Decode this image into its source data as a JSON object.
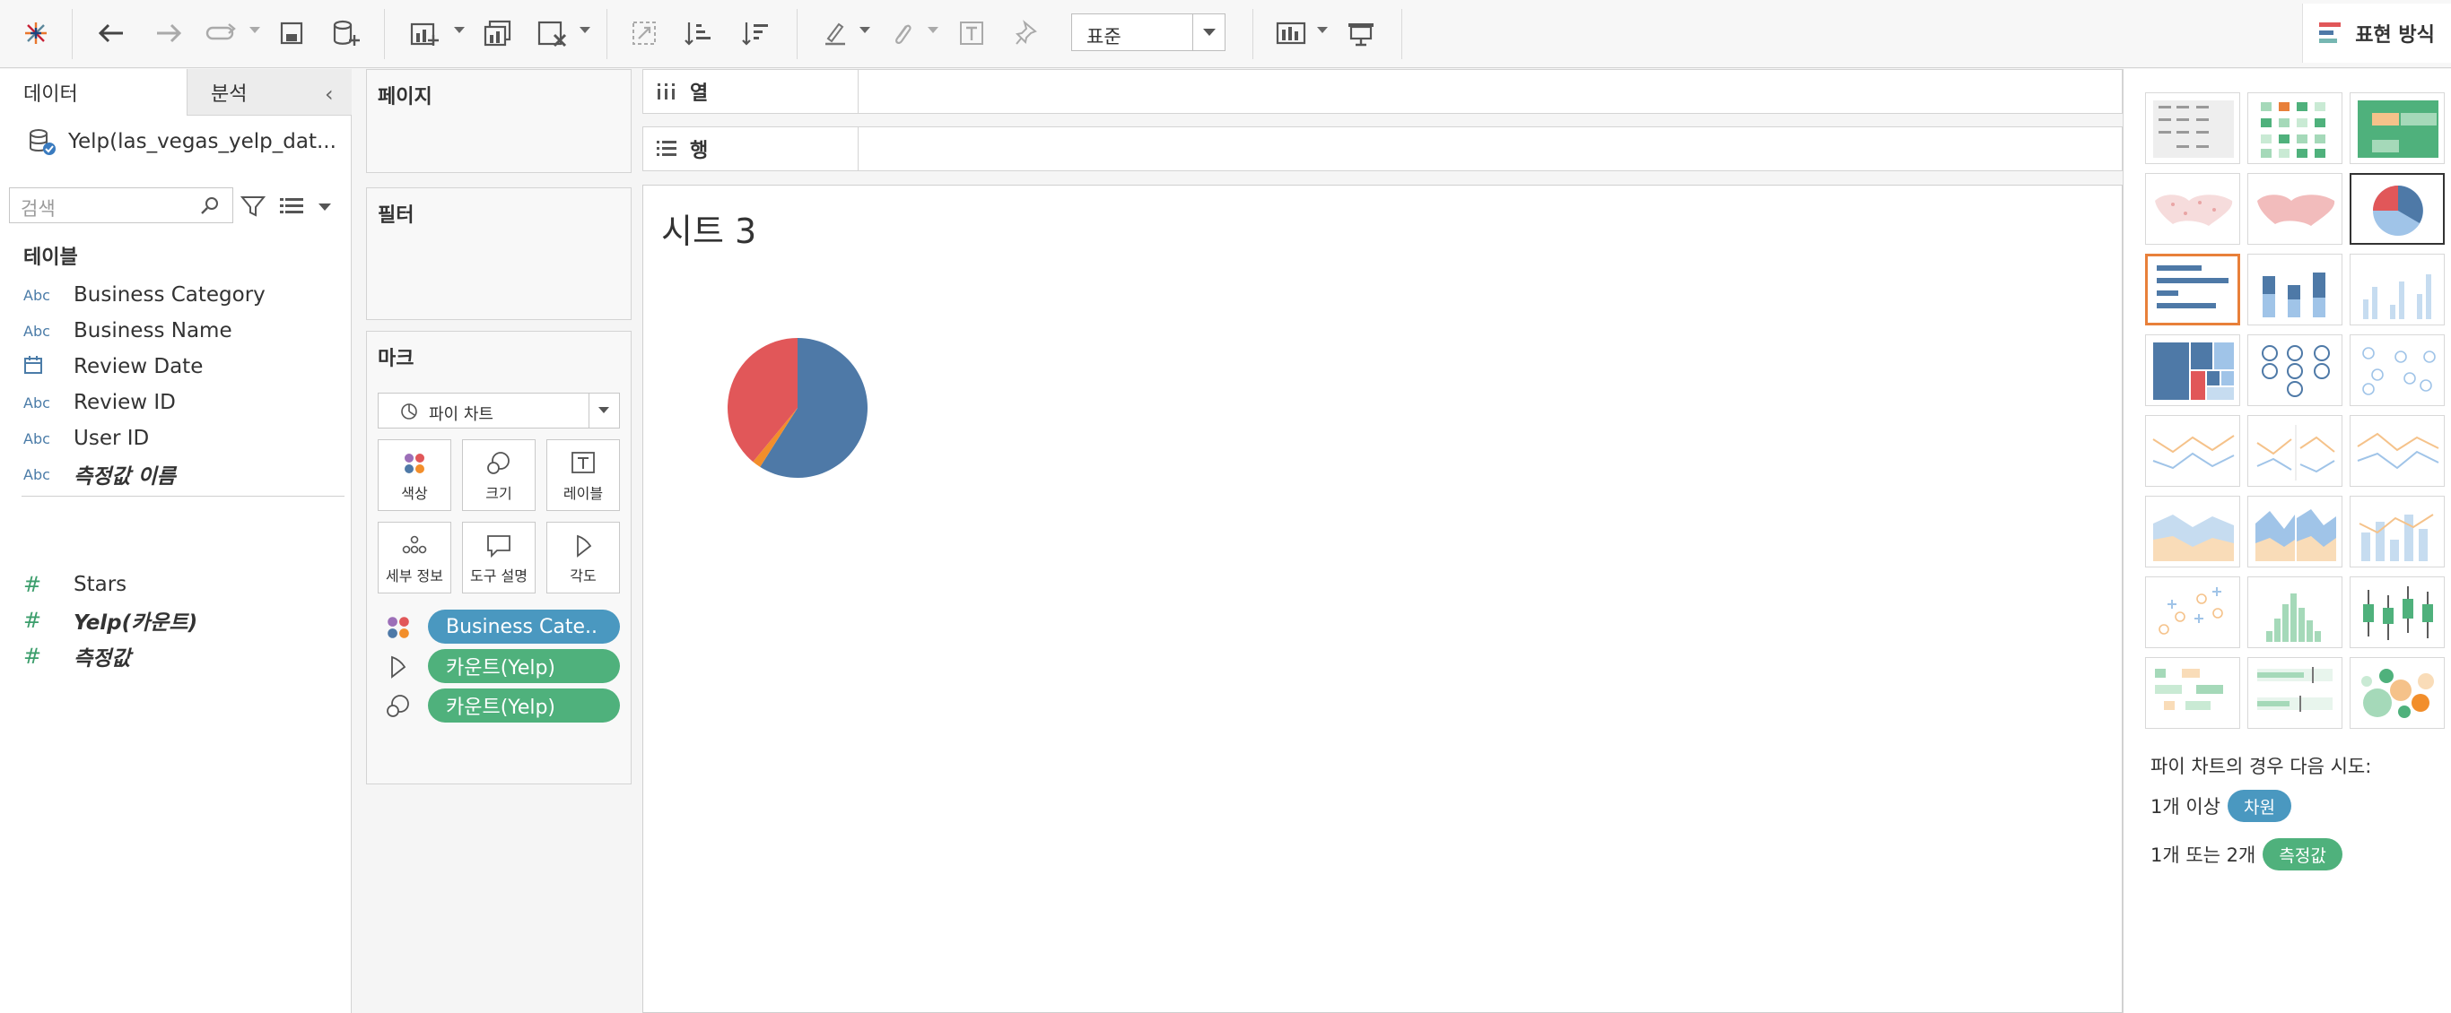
{
  "toolbar": {
    "fit_value": "표준",
    "show_me_label": "표현 방식"
  },
  "data_pane": {
    "tab_data": "데이터",
    "tab_analysis": "분석",
    "datasource": "Yelp(las_vegas_yelp_dat...",
    "search_placeholder": "검색",
    "tables_title": "테이블",
    "fields": [
      {
        "type": "Abc",
        "name": "Business Category"
      },
      {
        "type": "Abc",
        "name": "Business Name"
      },
      {
        "type": "date",
        "name": "Review Date"
      },
      {
        "type": "Abc",
        "name": "Review ID"
      },
      {
        "type": "Abc",
        "name": "User ID"
      },
      {
        "type": "Abc",
        "name": "측정값 이름"
      },
      {
        "type": "#",
        "name": "Stars"
      },
      {
        "type": "#",
        "name": "Yelp(카운트)"
      },
      {
        "type": "#",
        "name": "측정값"
      }
    ]
  },
  "cards": {
    "pages_title": "페이지",
    "filters_title": "필터",
    "marks_title": "마크",
    "marks_type": "파이 차트",
    "mark_buttons": [
      "색상",
      "크기",
      "레이블",
      "세부 정보",
      "도구 설명",
      "각도"
    ],
    "pills": [
      {
        "label": "Business Cate..",
        "color": "#4a98c0"
      },
      {
        "label": "카운트(Yelp)",
        "color": "#4fb17c"
      },
      {
        "label": "카운트(Yelp)",
        "color": "#4fb17c"
      }
    ]
  },
  "shelves": {
    "columns_label": "열",
    "rows_label": "행"
  },
  "view": {
    "sheet_title": "시트 3"
  },
  "chart_data": {
    "type": "pie",
    "categories": [
      "",
      "",
      ""
    ],
    "values": [
      59,
      2,
      39
    ],
    "colors": [
      "#4e79a7",
      "#f28e2b",
      "#e15759"
    ]
  },
  "show_me": {
    "hint_title": "파이 차트의 경우 다음 시도:",
    "hint1_text": "1개 이상",
    "hint1_pill": "차원",
    "hint2_text": "1개 또는 2개",
    "hint2_pill": "측정값"
  }
}
